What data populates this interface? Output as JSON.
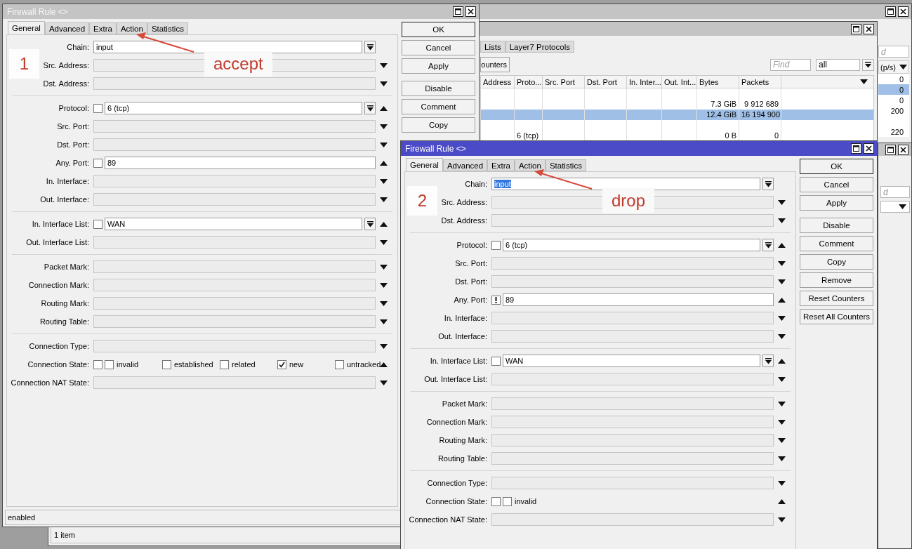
{
  "background_window": {
    "find_placeholder": "d",
    "column": "(p/s)",
    "rows": [
      {
        "value": "0",
        "selected": false
      },
      {
        "value": "0",
        "selected": true
      },
      {
        "value": "0",
        "selected": false
      },
      {
        "value": "200",
        "selected": false
      },
      {
        "selected": false
      },
      {
        "value": "220",
        "selected": false
      }
    ]
  },
  "rules_window": {
    "tabs": [
      {
        "label": "Lists",
        "selected": false
      },
      {
        "label": "Layer7 Protocols",
        "selected": false
      }
    ],
    "toolbar_button": "ounters",
    "find_placeholder": "Find",
    "filter": "all",
    "columns": [
      "Address",
      "Proto...",
      "Src. Port",
      "Dst. Port",
      "In. Inter...",
      "Out. Int...",
      "Bytes",
      "Packets"
    ],
    "rows": [
      {
        "selected": false
      },
      {
        "bytes": "7.3 GiB",
        "packets": "9 912 689",
        "selected": false
      },
      {
        "bytes": "12.4 GiB",
        "packets": "16 194 900",
        "selected": true
      },
      {
        "selected": false
      },
      {
        "protocol": "6 (tcp)",
        "bytes": "0 B",
        "packets": "0",
        "selected": false
      }
    ],
    "status": "1 item"
  },
  "side_window": {
    "find_placeholder": "d"
  },
  "rule_windows": [
    {
      "title": "Firewall Rule <>",
      "active": false,
      "tabs": [
        {
          "label": "General",
          "selected": true
        },
        {
          "label": "Advanced",
          "selected": false
        },
        {
          "label": "Extra",
          "selected": false
        },
        {
          "label": "Action",
          "selected": false
        },
        {
          "label": "Statistics",
          "selected": false
        }
      ],
      "marker": "1",
      "note": "accept",
      "groups": [
        [
          {
            "kind": "field",
            "label": "Chain:",
            "value": "input",
            "text_selected": false,
            "dropdown": true
          },
          {
            "kind": "field",
            "label": "Src. Address:",
            "dropdown": false,
            "expanded": false
          },
          {
            "kind": "field",
            "label": "Dst. Address:",
            "dropdown": false,
            "expanded": false
          }
        ],
        [
          {
            "kind": "field",
            "label": "Protocol:",
            "negate": false,
            "value": "6 (tcp)",
            "dropdown": true,
            "expanded": true
          },
          {
            "kind": "field",
            "label": "Src. Port:",
            "dropdown": false,
            "expanded": false
          },
          {
            "kind": "field",
            "label": "Dst. Port:",
            "dropdown": false,
            "expanded": false
          },
          {
            "kind": "field",
            "label": "Any. Port:",
            "negate": false,
            "value": "89",
            "dropdown": false,
            "expanded": true
          },
          {
            "kind": "field",
            "label": "In. Interface:",
            "dropdown": false,
            "expanded": false
          },
          {
            "kind": "field",
            "label": "Out. Interface:",
            "dropdown": false,
            "expanded": false
          }
        ],
        [
          {
            "kind": "field",
            "label": "In. Interface List:",
            "negate": false,
            "value": "WAN",
            "dropdown": true,
            "expanded": true
          },
          {
            "kind": "field",
            "label": "Out. Interface List:",
            "dropdown": false,
            "expanded": false
          }
        ],
        [
          {
            "kind": "field",
            "label": "Packet Mark:",
            "dropdown": false,
            "expanded": false
          },
          {
            "kind": "field",
            "label": "Connection Mark:",
            "dropdown": false,
            "expanded": false
          },
          {
            "kind": "field",
            "label": "Routing Mark:",
            "dropdown": false,
            "expanded": false
          },
          {
            "kind": "field",
            "label": "Routing Table:",
            "dropdown": false,
            "expanded": false
          }
        ],
        [
          {
            "kind": "field",
            "label": "Connection Type:",
            "dropdown": false,
            "expanded": false
          },
          {
            "kind": "states",
            "label": "Connection State:",
            "negate": false,
            "expanded": true,
            "options": [
              {
                "label": "invalid",
                "checked": false
              },
              {
                "label": "established",
                "checked": false
              },
              {
                "label": "related",
                "checked": false
              },
              {
                "label": "new",
                "checked": true
              },
              {
                "label": "untracked",
                "checked": false
              }
            ]
          },
          {
            "kind": "field",
            "label": "Connection NAT State:",
            "dropdown": false,
            "expanded": false
          }
        ]
      ],
      "button_groups": [
        [
          {
            "label": "OK",
            "default": true
          },
          {
            "label": "Cancel",
            "default": false
          },
          {
            "label": "Apply",
            "default": false
          }
        ],
        [
          {
            "label": "Disable",
            "default": false
          },
          {
            "label": "Comment",
            "default": false
          },
          {
            "label": "Copy",
            "default": false
          }
        ]
      ],
      "status": "enabled"
    },
    {
      "title": "Firewall Rule <>",
      "active": true,
      "tabs": [
        {
          "label": "General",
          "selected": true
        },
        {
          "label": "Advanced",
          "selected": false
        },
        {
          "label": "Extra",
          "selected": false
        },
        {
          "label": "Action",
          "selected": false
        },
        {
          "label": "Statistics",
          "selected": false
        }
      ],
      "marker": "2",
      "note": "drop",
      "groups": [
        [
          {
            "kind": "field",
            "label": "Chain:",
            "value": "input",
            "text_selected": true,
            "dropdown": true
          },
          {
            "kind": "field",
            "label": "Src. Address:",
            "dropdown": false,
            "expanded": false
          },
          {
            "kind": "field",
            "label": "Dst. Address:",
            "dropdown": false,
            "expanded": false
          }
        ],
        [
          {
            "kind": "field",
            "label": "Protocol:",
            "negate": false,
            "value": "6 (tcp)",
            "dropdown": true,
            "expanded": true
          },
          {
            "kind": "field",
            "label": "Src. Port:",
            "dropdown": false,
            "expanded": false
          },
          {
            "kind": "field",
            "label": "Dst. Port:",
            "dropdown": false,
            "expanded": false
          },
          {
            "kind": "field",
            "label": "Any. Port:",
            "negate": true,
            "value": "89",
            "dropdown": false,
            "expanded": true
          },
          {
            "kind": "field",
            "label": "In. Interface:",
            "dropdown": false,
            "expanded": false
          },
          {
            "kind": "field",
            "label": "Out. Interface:",
            "dropdown": false,
            "expanded": false
          }
        ],
        [
          {
            "kind": "field",
            "label": "In. Interface List:",
            "negate": false,
            "value": "WAN",
            "dropdown": true,
            "expanded": true
          },
          {
            "kind": "field",
            "label": "Out. Interface List:",
            "dropdown": false,
            "expanded": false
          }
        ],
        [
          {
            "kind": "field",
            "label": "Packet Mark:",
            "dropdown": false,
            "expanded": false
          },
          {
            "kind": "field",
            "label": "Connection Mark:",
            "dropdown": false,
            "expanded": false
          },
          {
            "kind": "field",
            "label": "Routing Mark:",
            "dropdown": false,
            "expanded": false
          },
          {
            "kind": "field",
            "label": "Routing Table:",
            "dropdown": false,
            "expanded": false
          }
        ],
        [
          {
            "kind": "field",
            "label": "Connection Type:",
            "dropdown": false,
            "expanded": false
          },
          {
            "kind": "states",
            "label": "Connection State:",
            "negate": false,
            "expanded": true,
            "options": [
              {
                "label": "invalid",
                "checked": false
              }
            ]
          },
          {
            "kind": "field",
            "label": "Connection NAT State:",
            "dropdown": false,
            "expanded": false
          }
        ]
      ],
      "button_groups": [
        [
          {
            "label": "OK",
            "default": true
          },
          {
            "label": "Cancel",
            "default": false
          },
          {
            "label": "Apply",
            "default": false
          }
        ],
        [
          {
            "label": "Disable",
            "default": false
          },
          {
            "label": "Comment",
            "default": false
          },
          {
            "label": "Copy",
            "default": false
          },
          {
            "label": "Remove",
            "default": false
          },
          {
            "label": "Reset Counters",
            "default": false
          },
          {
            "label": "Reset All Counters",
            "default": false
          }
        ]
      ]
    }
  ]
}
